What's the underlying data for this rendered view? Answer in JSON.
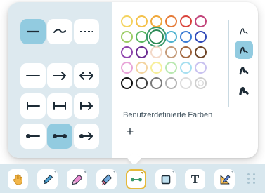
{
  "colors": {
    "accent": "#92cbe0",
    "panel": "#dde9ef",
    "toolbar": "#d8e7ee",
    "selected_tool_border": "#e5b93a"
  },
  "line_styles": [
    {
      "name": "solid",
      "selected": true
    },
    {
      "name": "wavy",
      "selected": false
    },
    {
      "name": "dashed",
      "selected": false
    }
  ],
  "line_ends": [
    {
      "name": "plain-line",
      "selected": false
    },
    {
      "name": "arrow-right",
      "selected": false
    },
    {
      "name": "arrow-both",
      "selected": false
    },
    {
      "name": "bar-start",
      "selected": false
    },
    {
      "name": "bar-both",
      "selected": false
    },
    {
      "name": "bar-arrow",
      "selected": false
    },
    {
      "name": "dot-start",
      "selected": false
    },
    {
      "name": "dot-both",
      "selected": true
    },
    {
      "name": "dot-arrow",
      "selected": false
    }
  ],
  "palette": [
    [
      "#f4d35e",
      "#f4c24c",
      "#f0a93c",
      "#e57a37",
      "#d9433a",
      "#c2447a"
    ],
    [
      "#9ccc65",
      "#5bb85f",
      "#2e8b57",
      "#4fb3cf",
      "#3a7bd5",
      "#3049b8"
    ],
    [
      "#8e44ad",
      "#6a2c91",
      "#f3d9c8",
      "#c49b7a",
      "#a2673f",
      "#6d4426"
    ],
    [
      "#e8a4d8",
      "#f3d4a0",
      "#f7ef9a",
      "#b9e8b0",
      "#a6dff0",
      "#c9c2f0"
    ],
    [
      "#111111",
      "#3f3f3f",
      "#7a7a7a",
      "#b2b2b2",
      "#dcdcdc",
      null
    ]
  ],
  "selected_color": "#2e8b57",
  "brush_sizes": [
    "thin",
    "medium",
    "thick",
    "extra-thick"
  ],
  "selected_brush": "medium",
  "custom_colors_label": "Benutzerdefinierte Farben",
  "add_label": "+",
  "toolbar": {
    "tools": [
      "hand",
      "pen",
      "highlighter",
      "eraser",
      "line",
      "shape",
      "text",
      "ruler"
    ],
    "selected": "line",
    "text_tool_glyph": "T"
  }
}
